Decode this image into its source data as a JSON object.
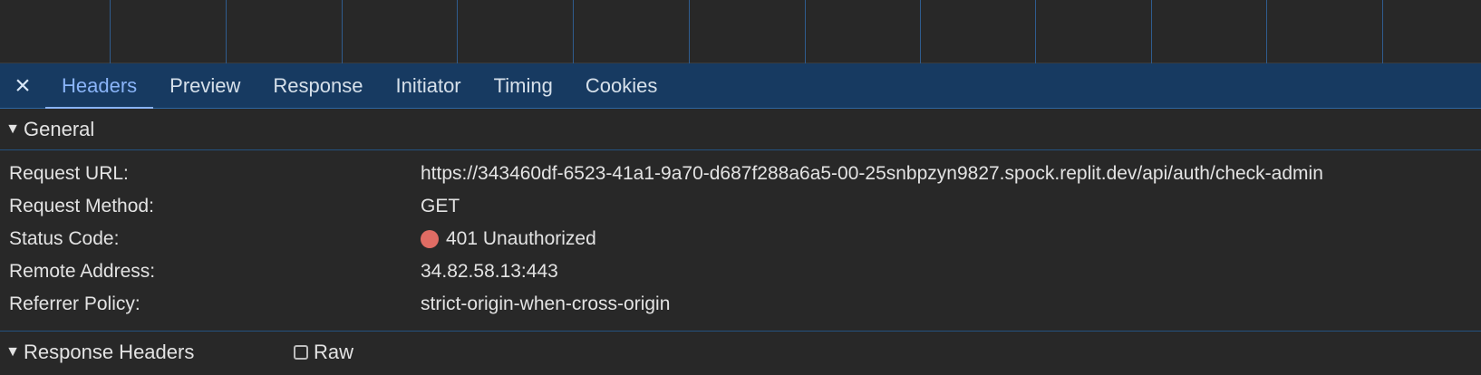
{
  "tabs": [
    {
      "label": "Headers",
      "active": true
    },
    {
      "label": "Preview",
      "active": false
    },
    {
      "label": "Response",
      "active": false
    },
    {
      "label": "Initiator",
      "active": false
    },
    {
      "label": "Timing",
      "active": false
    },
    {
      "label": "Cookies",
      "active": false
    }
  ],
  "icons": {
    "close": "×",
    "collapse": "▼"
  },
  "general": {
    "title": "General",
    "rows": [
      {
        "label": "Request URL:",
        "value": "https://343460df-6523-41a1-9a70-d687f288a6a5-00-25snbpzyn9827.spock.replit.dev/api/auth/check-admin"
      },
      {
        "label": "Request Method:",
        "value": "GET"
      },
      {
        "label": "Status Code:",
        "value": "401 Unauthorized"
      },
      {
        "label": "Remote Address:",
        "value": "34.82.58.13:443"
      },
      {
        "label": "Referrer Policy:",
        "value": "strict-origin-when-cross-origin"
      }
    ]
  },
  "response_headers": {
    "title": "Response Headers",
    "raw_label": "Raw",
    "raw_checked": false
  },
  "colors": {
    "background": "#282828",
    "tabbar": "#173a61",
    "active_tab": "#8ab4f8",
    "status_error": "#e06c64"
  }
}
